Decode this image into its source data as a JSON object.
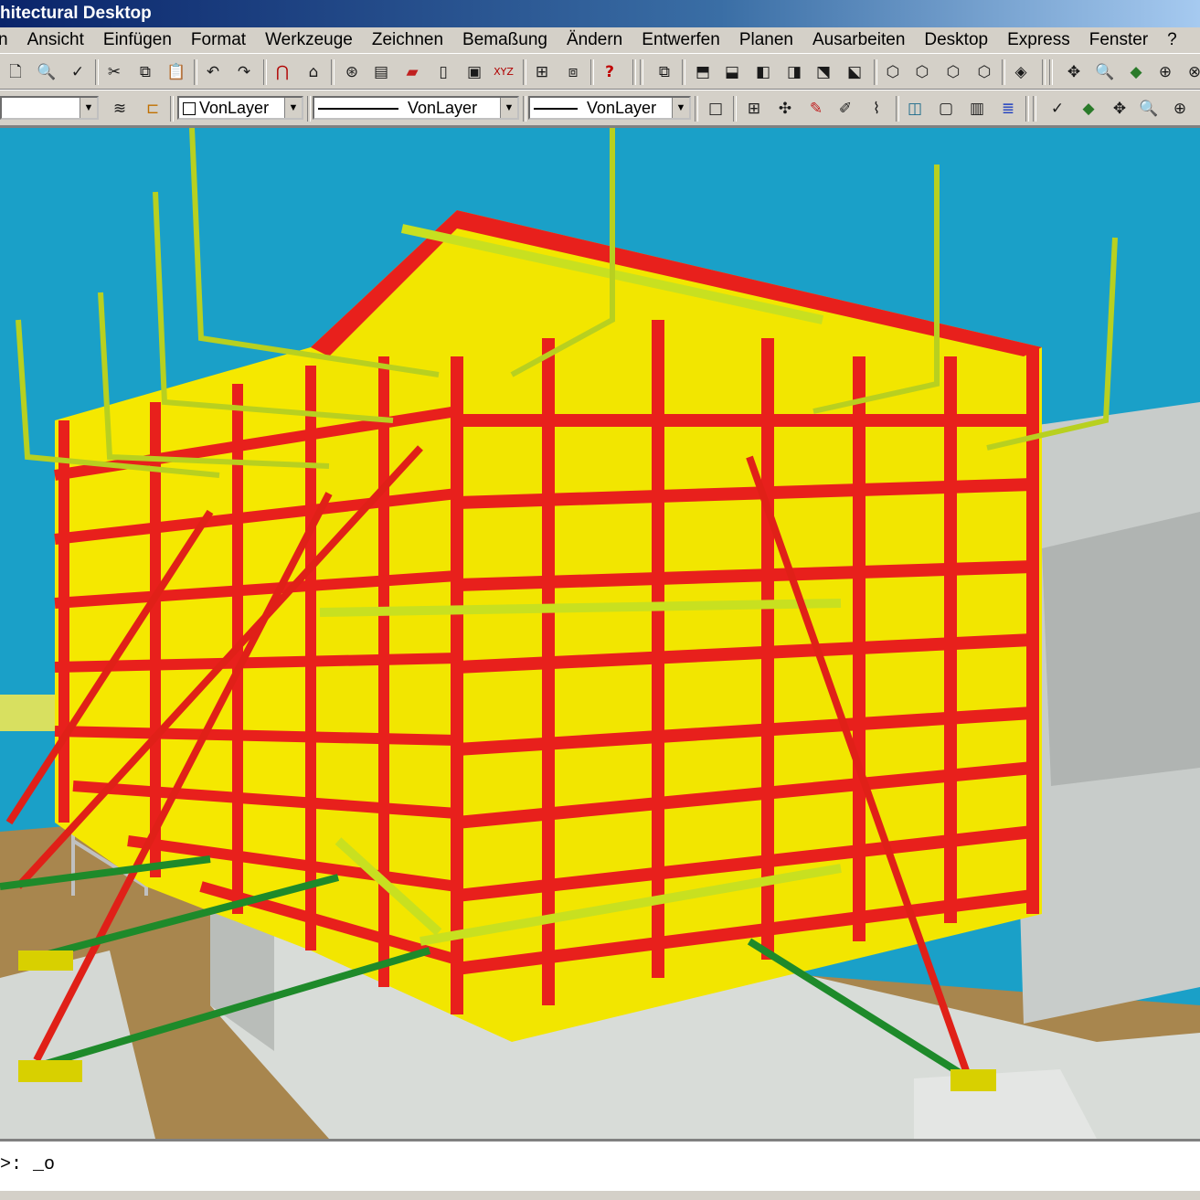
{
  "window": {
    "title": "hitectural Desktop"
  },
  "menu": [
    "n",
    "Ansicht",
    "Einfügen",
    "Format",
    "Werkzeuge",
    "Zeichnen",
    "Bemaßung",
    "Ändern",
    "Entwerfen",
    "Planen",
    "Ausarbeiten",
    "Desktop",
    "Express",
    "Fenster",
    "?"
  ],
  "toolbar2": {
    "color_value": "VonLayer",
    "linetype_value": "VonLayer",
    "lineweight_value": "VonLayer"
  },
  "command": {
    "prompt": ">: _o"
  },
  "colors": {
    "sky": "#1aa0c8",
    "formwork_red": "#e8201c",
    "panel_yellow": "#f2e600",
    "brace_green": "#1e8a2a",
    "concrete": "#d8dcd8"
  }
}
